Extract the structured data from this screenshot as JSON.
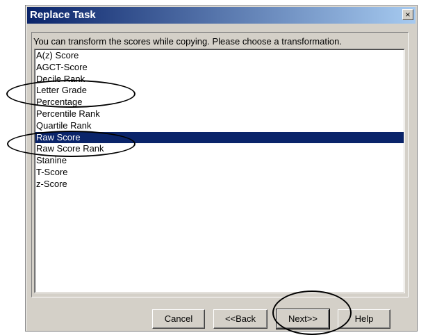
{
  "window": {
    "title": "Replace Task",
    "close_label": "×"
  },
  "instruction": "You can transform the scores while copying. Please choose a transformation.",
  "list": {
    "items": [
      "A(z) Score",
      "AGCT-Score",
      "Decile Rank",
      "Letter Grade",
      "Percentage",
      "Percentile Rank",
      "Quartile Rank",
      "Raw Score",
      "Raw Score Rank",
      "Stanine",
      "T-Score",
      "z-Score"
    ],
    "selected": "Raw Score"
  },
  "buttons": {
    "cancel": "Cancel",
    "back": "<<Back",
    "next": "Next>>",
    "help": "Help"
  },
  "colors": {
    "selection": "#0a246a",
    "titlebar": "#0a246a",
    "dialog_bg": "#d4d0c8"
  }
}
